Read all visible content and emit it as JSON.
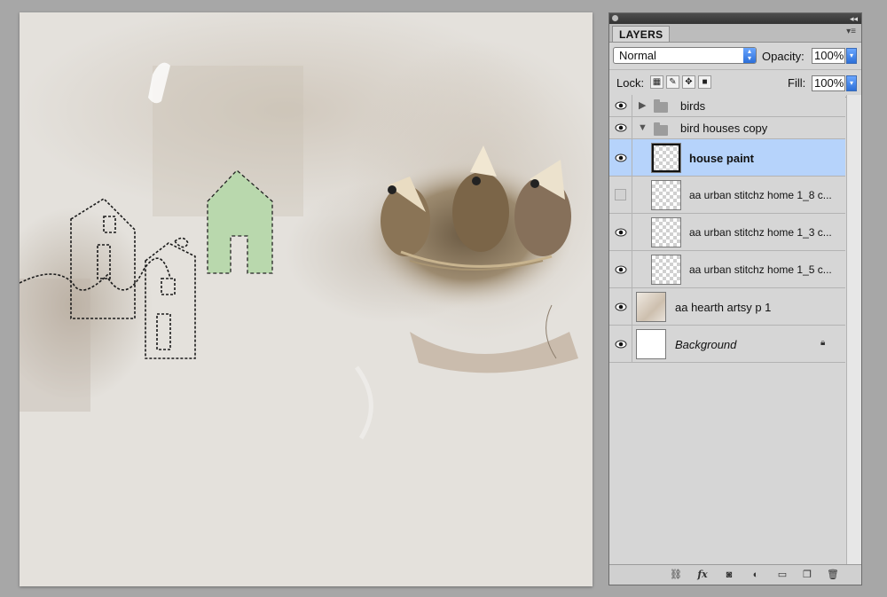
{
  "panel": {
    "tab_label": "LAYERS",
    "blend_mode": "Normal",
    "opacity_label": "Opacity:",
    "opacity_value": "100%",
    "lock_label": "Lock:",
    "fill_label": "Fill:",
    "fill_value": "100%"
  },
  "layers": [
    {
      "name": "birds",
      "type": "group",
      "expanded": false,
      "visible": true
    },
    {
      "name": "bird houses copy",
      "type": "group",
      "expanded": true,
      "visible": true
    },
    {
      "name": "house paint",
      "type": "layer",
      "selected": true,
      "visible": true
    },
    {
      "name": "aa urban stitchz home 1_8 c...",
      "type": "layer",
      "visible": false
    },
    {
      "name": "aa urban stitchz home 1_3 c...",
      "type": "layer",
      "visible": true
    },
    {
      "name": "aa urban stitchz home 1_5 c...",
      "type": "layer",
      "visible": true
    },
    {
      "name": "aa hearth artsy p 1",
      "type": "layer",
      "visible": true
    },
    {
      "name": "Background",
      "type": "background",
      "visible": true,
      "locked": true
    }
  ],
  "icons": {
    "link": "link-icon",
    "fx": "fx",
    "mask": "mask-icon",
    "adjustment": "adjustment-icon",
    "group": "folder-icon",
    "new": "new-layer-icon",
    "delete": "trash-icon"
  },
  "colors": {
    "selection_bg": "#b6d3fb",
    "house_paint_green": "#b9d8ad",
    "panel_bg": "#d6d6d6"
  }
}
